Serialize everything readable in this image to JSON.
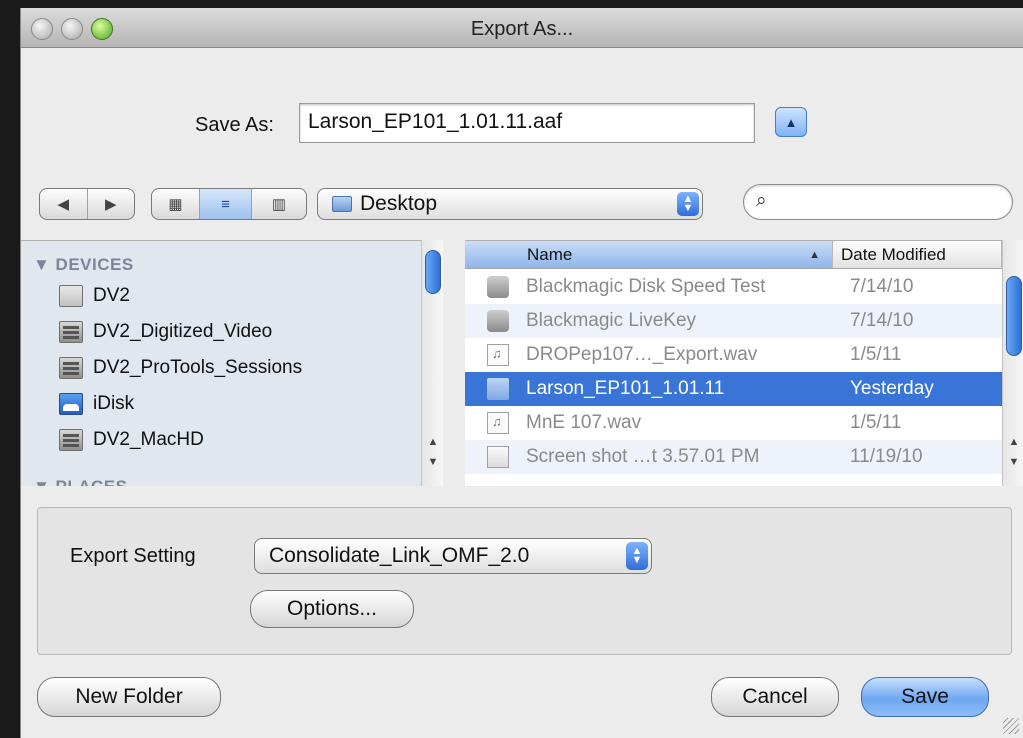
{
  "window": {
    "title": "Export As..."
  },
  "save_as": {
    "label": "Save As:",
    "value": "Larson_EP101_1.01.11.aaf"
  },
  "toolbar": {
    "location": "Desktop",
    "back_icon": "◀",
    "forward_icon": "▶",
    "view_icons": "icon-view-icon",
    "search_placeholder": ""
  },
  "sidebar": {
    "devices_header": "▼ DEVICES",
    "places_header": "▼ PLACES",
    "devices": [
      {
        "label": "DV2",
        "icon": "drive-icon"
      },
      {
        "label": "DV2_Digitized_Video",
        "icon": "disk-icon"
      },
      {
        "label": "DV2_ProTools_Sessions",
        "icon": "disk-icon"
      },
      {
        "label": "iDisk",
        "icon": "idisk-icon"
      },
      {
        "label": "DV2_MacHD",
        "icon": "disk-icon"
      }
    ]
  },
  "file_list": {
    "columns": [
      "Name",
      "Date Modified"
    ],
    "rows": [
      {
        "name": "Blackmagic Disk Speed Test",
        "date": "7/14/10",
        "icon": "app-icon",
        "selected": false
      },
      {
        "name": "Blackmagic LiveKey",
        "date": "7/14/10",
        "icon": "app-icon",
        "selected": false
      },
      {
        "name": "DROPep107…_Export.wav",
        "date": "1/5/11",
        "icon": "audio-file-icon",
        "selected": false
      },
      {
        "name": "Larson_EP101_1.01.11",
        "date": "Yesterday",
        "icon": "folder-icon",
        "selected": true
      },
      {
        "name": "MnE 107.wav",
        "date": "1/5/11",
        "icon": "audio-file-icon",
        "selected": false
      },
      {
        "name": "Screen shot …t 3.57.01 PM",
        "date": "11/19/10",
        "icon": "image-file-icon",
        "selected": false
      }
    ]
  },
  "export": {
    "setting_label": "Export Setting",
    "setting_value": "Consolidate_Link_OMF_2.0",
    "options_label": "Options..."
  },
  "buttons": {
    "new_folder": "New Folder",
    "cancel": "Cancel",
    "save": "Save"
  }
}
